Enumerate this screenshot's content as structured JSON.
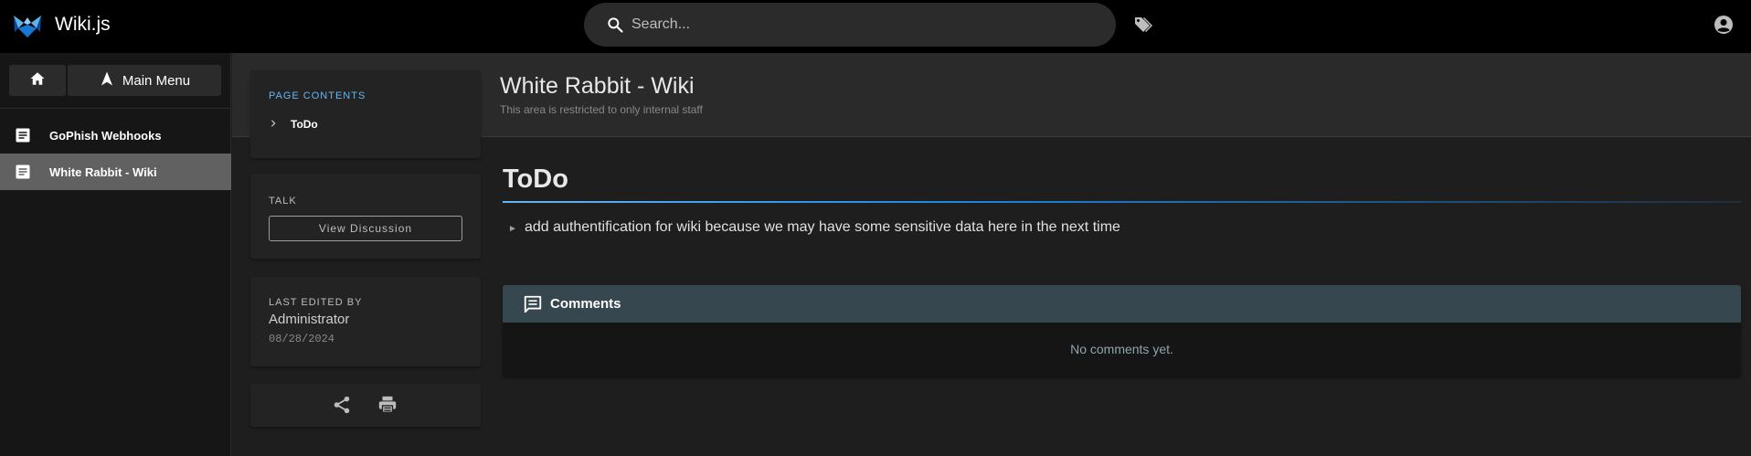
{
  "app": {
    "brand": "Wiki.js"
  },
  "search": {
    "placeholder": "Search..."
  },
  "leftnav": {
    "main_menu_label": "Main Menu",
    "items": [
      {
        "label": "GoPhish Webhooks",
        "active": false
      },
      {
        "label": "White Rabbit - Wiki",
        "active": true
      }
    ]
  },
  "page": {
    "title": "White Rabbit - Wiki",
    "subtitle": "This area is restricted to only internal staff"
  },
  "toc": {
    "label": "PAGE CONTENTS",
    "items": [
      "ToDo"
    ]
  },
  "talk": {
    "label": "TALK",
    "button": "View Discussion"
  },
  "last_edited": {
    "label": "LAST EDITED BY",
    "name": "Administrator",
    "date": "08/28/2024"
  },
  "content": {
    "heading": "ToDo",
    "items": [
      "add authentification for wiki because we may have some sensitive data here in the next time"
    ]
  },
  "comments": {
    "title": "Comments",
    "empty": "No comments yet."
  },
  "colors": {
    "accent": "#64b5f6",
    "active_nav": "#616161",
    "comments_header": "#37474f"
  }
}
